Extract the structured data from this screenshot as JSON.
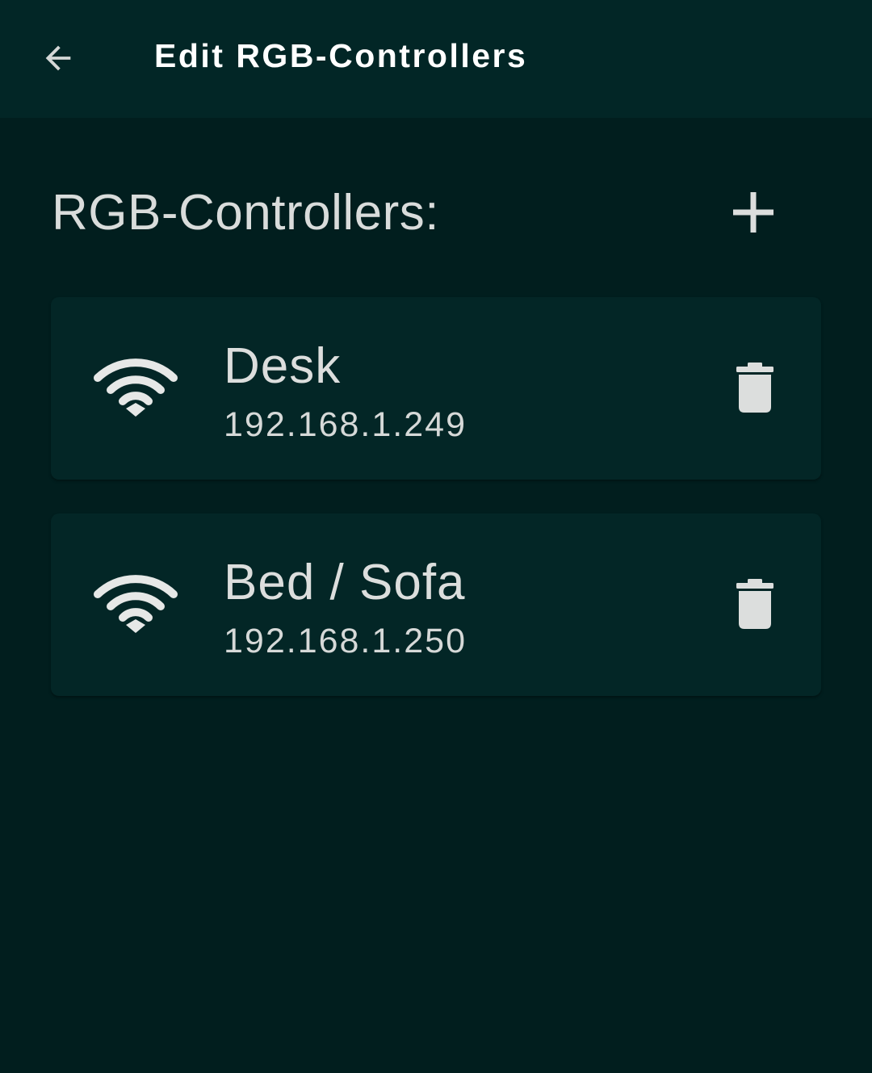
{
  "appbar": {
    "title": "Edit RGB-Controllers",
    "back_icon": "arrow-back-icon"
  },
  "section": {
    "title": "RGB-Controllers:",
    "add_icon": "plus-icon"
  },
  "controllers": [
    {
      "name": "Desk",
      "ip": "192.168.1.249",
      "icon": "wifi-icon",
      "action_icon": "trash-icon"
    },
    {
      "name": "Bed / Sofa",
      "ip": "192.168.1.250",
      "icon": "wifi-icon",
      "action_icon": "trash-icon"
    }
  ],
  "colors": {
    "background": "#011e1e",
    "appbar": "#022626",
    "card": "#032626",
    "text": "#d9dcdb",
    "title": "#ffffff"
  }
}
